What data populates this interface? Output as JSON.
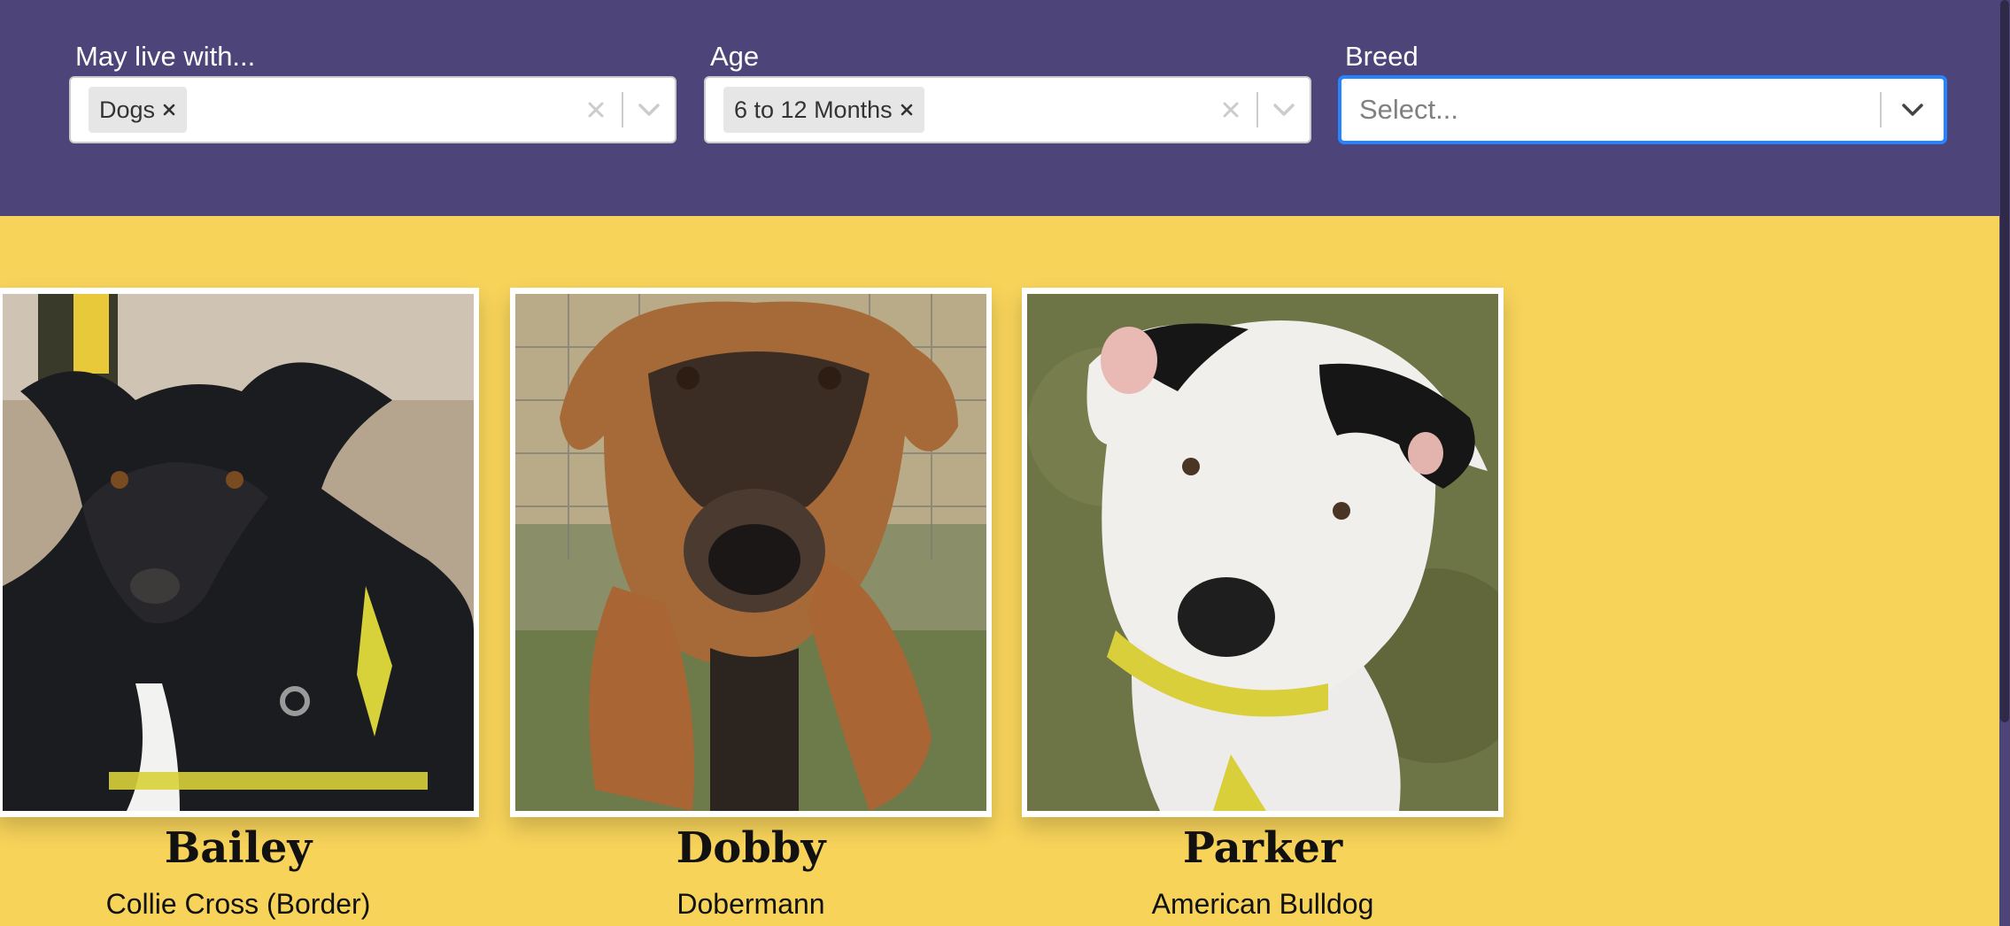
{
  "filters": {
    "live_with": {
      "label": "May live with...",
      "selected": [
        "Dogs"
      ]
    },
    "age": {
      "label": "Age",
      "selected": [
        "6 to 12 Months"
      ]
    },
    "breed": {
      "label": "Breed",
      "placeholder": "Select..."
    }
  },
  "dogs": [
    {
      "name": "Bailey",
      "breed": "Collie Cross (Border)"
    },
    {
      "name": "Dobby",
      "breed": "Dobermann"
    },
    {
      "name": "Parker",
      "breed": "American Bulldog"
    }
  ],
  "colors": {
    "header_bg": "#4d4579",
    "page_bg": "#f7d35a",
    "focus_border": "#2684ff"
  },
  "icons": {
    "chip_remove": "close-icon",
    "clear": "clear-icon",
    "dropdown": "chevron-down-icon"
  }
}
